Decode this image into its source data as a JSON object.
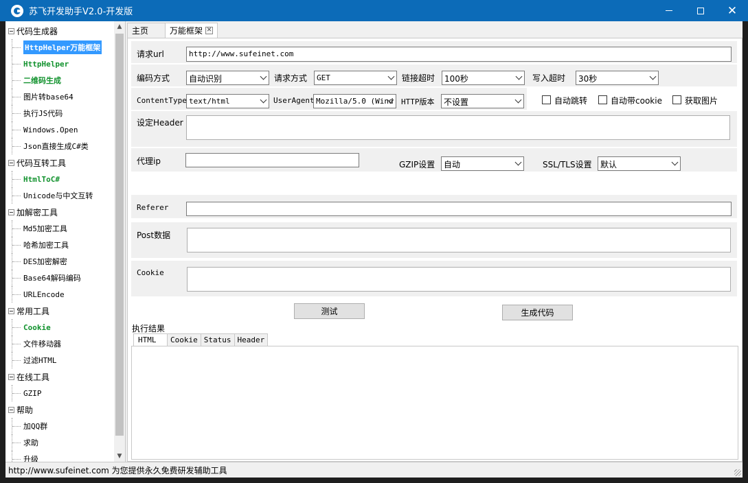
{
  "window": {
    "title": "苏飞开发助手V2.0-开发版",
    "minimize": "minimize",
    "maximize": "maximize",
    "close": "✕"
  },
  "tree": {
    "groups": [
      {
        "label": "代码生成器",
        "items": [
          {
            "label": "HttpHelper万能框架",
            "style": "selected"
          },
          {
            "label": "HttpHelper",
            "style": "green"
          },
          {
            "label": "二维码生成",
            "style": "green"
          },
          {
            "label": "图片转base64",
            "style": "normal"
          },
          {
            "label": "执行JS代码",
            "style": "normal"
          },
          {
            "label": "Windows.Open",
            "style": "normal"
          },
          {
            "label": "Json直接生成C#类",
            "style": "normal"
          }
        ]
      },
      {
        "label": "代码互转工具",
        "items": [
          {
            "label": "HtmlToC#",
            "style": "green"
          },
          {
            "label": "Unicode与中文互转",
            "style": "normal"
          }
        ]
      },
      {
        "label": "加解密工具",
        "items": [
          {
            "label": "Md5加密工具",
            "style": "normal"
          },
          {
            "label": "哈希加密工具",
            "style": "normal"
          },
          {
            "label": "DES加密解密",
            "style": "normal"
          },
          {
            "label": "Base64解码编码",
            "style": "normal"
          },
          {
            "label": "URLEncode",
            "style": "normal"
          }
        ]
      },
      {
        "label": "常用工具",
        "items": [
          {
            "label": "Cookie",
            "style": "green"
          },
          {
            "label": "文件移动器",
            "style": "normal"
          },
          {
            "label": "过滤HTML",
            "style": "normal"
          }
        ]
      },
      {
        "label": "在线工具",
        "items": [
          {
            "label": "GZIP",
            "style": "normal"
          }
        ]
      },
      {
        "label": "帮助",
        "items": [
          {
            "label": "加QQ群",
            "style": "normal"
          },
          {
            "label": "求助",
            "style": "normal"
          },
          {
            "label": "升级",
            "style": "normal"
          }
        ]
      }
    ]
  },
  "tabs": {
    "home": "主页",
    "framework": "万能框架"
  },
  "form": {
    "url_label": "请求url",
    "url_value": "http://www.sufeinet.com",
    "encoding_label": "编码方式",
    "encoding_value": "自动识别",
    "method_label": "请求方式",
    "method_value": "GET",
    "timeout_label": "链接超时",
    "timeout_value": "100秒",
    "write_timeout_label": "写入超时",
    "write_timeout_value": "30秒",
    "content_type_label": "ContentType",
    "content_type_value": "text/html",
    "user_agent_label": "UserAgent",
    "user_agent_value": "Mozilla/5.0 (Wind",
    "http_version_label": "HTTP版本",
    "http_version_value": "不设置",
    "auto_redirect_label": "自动跳转",
    "auto_cookie_label": "自动带cookie",
    "get_images_label": "获取图片",
    "header_label": "设定Header",
    "proxy_label": "代理ip",
    "gzip_label": "GZIP设置",
    "gzip_value": "自动",
    "ssl_label": "SSL/TLS设置",
    "ssl_value": "默认",
    "referer_label": "Referer",
    "post_label": "Post数据",
    "cookie_label": "Cookie",
    "test_button": "测试",
    "generate_button": "生成代码"
  },
  "result": {
    "title": "执行结果",
    "tabs": [
      "HTML",
      "Cookie",
      "Status",
      "Header"
    ]
  },
  "status": {
    "text": "http://www.sufeinet.com 为您提供永久免费研发辅助工具"
  }
}
